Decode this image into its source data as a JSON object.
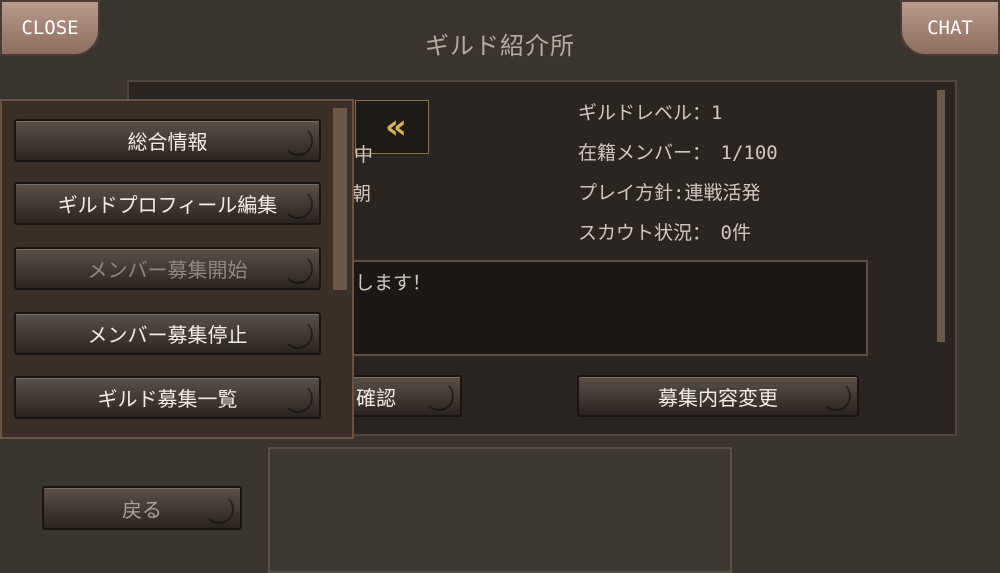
{
  "header": {
    "title": "ギルド紹介所",
    "close_label": "CLOSE",
    "chat_label": "CHAT"
  },
  "guild_info": {
    "level": "ギルドレベル：1",
    "members": "在籍メンバー：　1/100",
    "policy": "プレイ方針:連戦活発",
    "scout": "スカウト状況：　0件"
  },
  "behind_text": {
    "frag1": "中",
    "frag2": "朝",
    "message": "します！",
    "confirm_label": "確認"
  },
  "recruit_change_label": "募集内容変更",
  "menu": {
    "items": [
      {
        "label": "総合情報"
      },
      {
        "label": "ギルドプロフィール編集"
      },
      {
        "label": "メンバー募集開始"
      },
      {
        "label": "メンバー募集停止"
      },
      {
        "label": "ギルド募集一覧"
      }
    ]
  },
  "back_label": "戻る",
  "colors": {
    "accent_gold": "#d6b35a",
    "button_text": "#f2ede6",
    "disabled_text": "#8f8880"
  }
}
